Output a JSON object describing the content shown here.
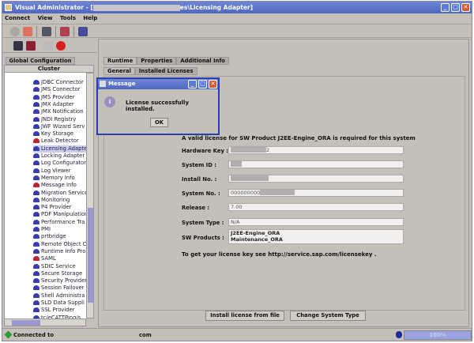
{
  "window": {
    "title_prefix": "Visual Administrator - [",
    "title_suffix": "es\\Licensing Adapter]"
  },
  "menu": [
    "Connect",
    "View",
    "Tools",
    "Help"
  ],
  "left": {
    "tab": "Global Configuration",
    "header": "Cluster",
    "tree": [
      {
        "label": "JDBC Connector"
      },
      {
        "label": "JMS Connector"
      },
      {
        "label": "JMS Provider"
      },
      {
        "label": "JMX Adapter"
      },
      {
        "label": "JMX Notification"
      },
      {
        "label": "JNDI Registry"
      },
      {
        "label": "JWF Wizard Serv"
      },
      {
        "label": "Key Storage"
      },
      {
        "label": "Leak Detector",
        "red": true
      },
      {
        "label": "Licensing Adapter",
        "selected": true
      },
      {
        "label": "Locking Adapter"
      },
      {
        "label": "Log Configurator"
      },
      {
        "label": "Log Viewer"
      },
      {
        "label": "Memory Info"
      },
      {
        "label": "Message Info",
        "red": true
      },
      {
        "label": "Migration Service"
      },
      {
        "label": "Monitoring"
      },
      {
        "label": "P4 Provider"
      },
      {
        "label": "PDF Manipulation"
      },
      {
        "label": "Performance Tra"
      },
      {
        "label": "PMI"
      },
      {
        "label": "prtbridge"
      },
      {
        "label": "Remote Object C"
      },
      {
        "label": "Runtime Info Pro"
      },
      {
        "label": "SAML",
        "red": true
      },
      {
        "label": "SDIC Service"
      },
      {
        "label": "Secure Storage"
      },
      {
        "label": "Security Provider"
      },
      {
        "label": "Session Failover"
      },
      {
        "label": "Shell Administra"
      },
      {
        "label": "SLD Data Suppli"
      },
      {
        "label": "SSL Provider"
      },
      {
        "label": "tc/eCATTPing/s"
      }
    ]
  },
  "tabs": [
    "Runtime",
    "Properties",
    "Additional Info"
  ],
  "subtabs": [
    "General",
    "Installed Licenses"
  ],
  "form": {
    "notice": "A valid license for SW Product J2EE-Engine_ORA is required for this system",
    "hardware_key_label": "Hardware Key :",
    "hardware_key": "2",
    "system_id_label": "System ID :",
    "install_no_label": "Install No. :",
    "system_no_label": "System No. :",
    "system_no": "000000000",
    "release_label": "Release :",
    "release": "7.00",
    "system_type_label": "System Type :",
    "system_type": "N/A",
    "sw_products_label": "SW Products :",
    "sw_products": [
      "J2EE-Engine_ORA",
      "Maintenance_ORA"
    ],
    "url_text": "To get your license key see http://service.sap.com/licensekey ."
  },
  "buttons": {
    "install": "Install license from file",
    "change": "Change System Type"
  },
  "dialog": {
    "title": "Message",
    "text": "License successfully installed.",
    "ok": "OK"
  },
  "status": {
    "connected": "Connected to",
    "host": "com",
    "progress": "100%",
    "progress_value": 100
  }
}
